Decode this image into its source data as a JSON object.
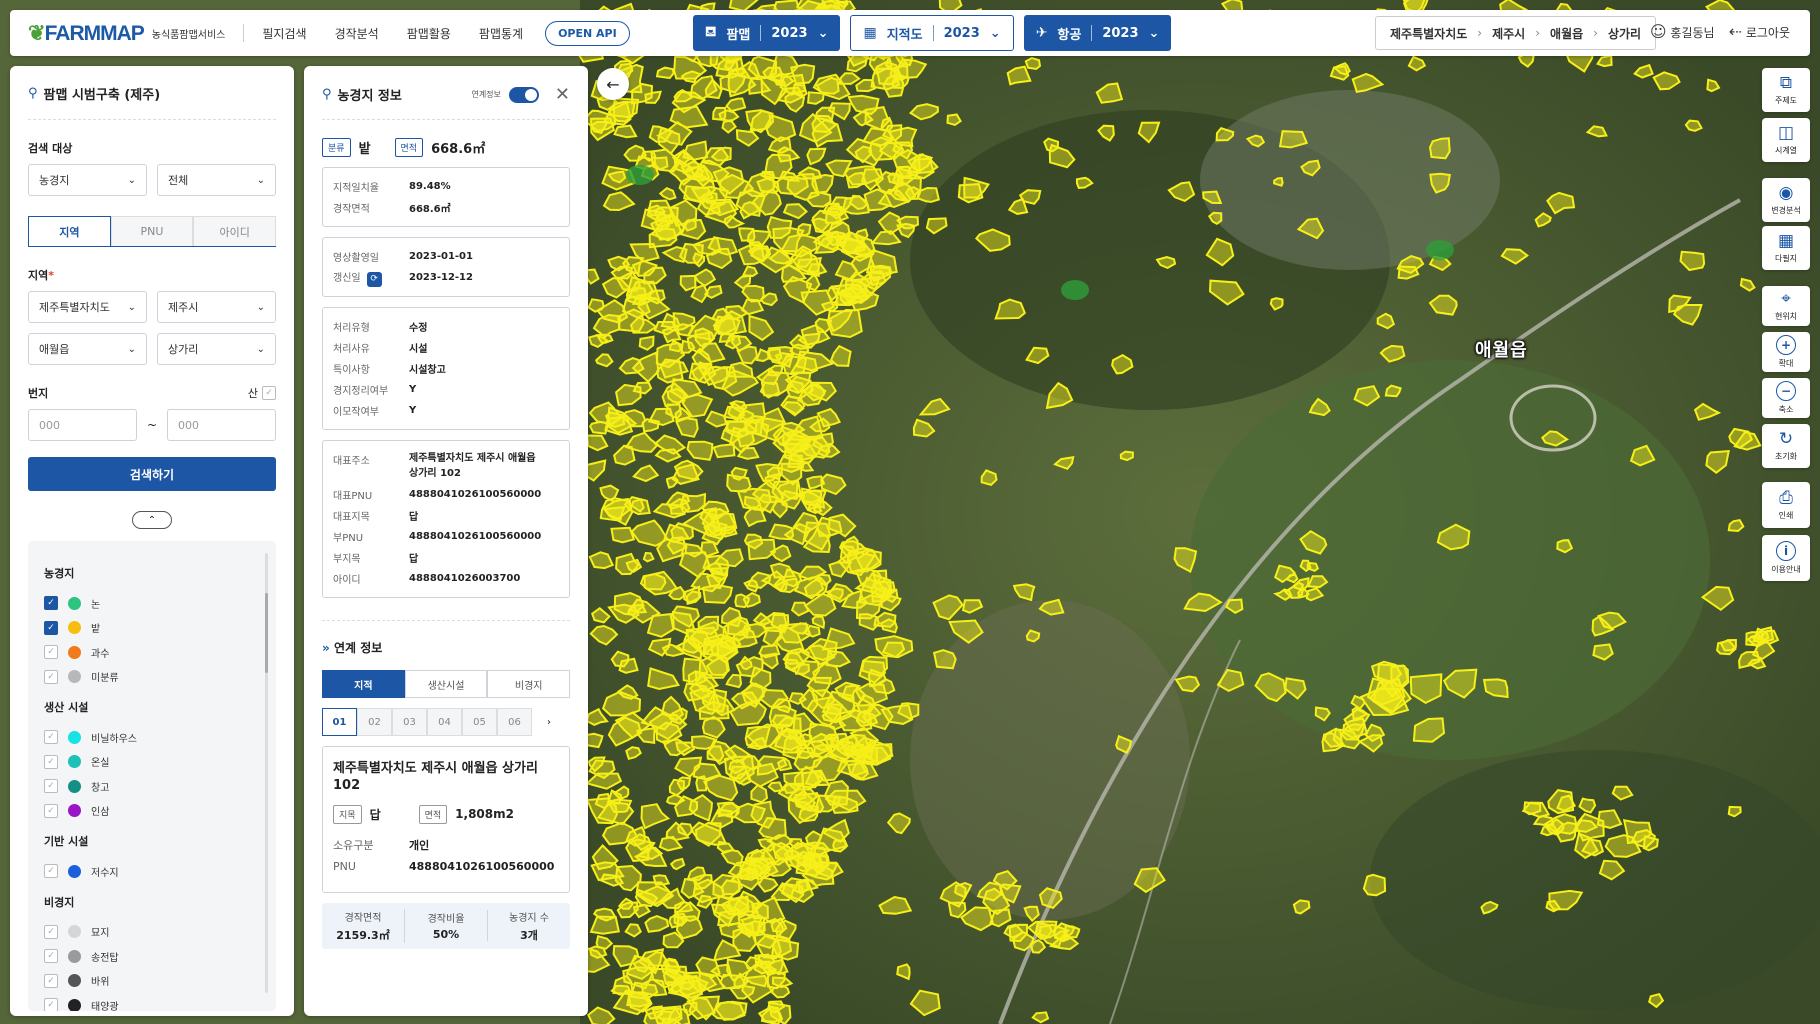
{
  "header": {
    "logo": "FARMMAP",
    "logo_sub": "농식품팜맵서비스",
    "nav": [
      "필지검색",
      "경작분석",
      "팜맵활용",
      "팜맵통계"
    ],
    "open_api": "OPEN API",
    "layers": [
      {
        "label": "팜맵",
        "year": "2023",
        "style": "blue",
        "icon": "farm-icon"
      },
      {
        "label": "지적도",
        "year": "2023",
        "style": "white",
        "icon": "cadastral-icon"
      },
      {
        "label": "항공",
        "year": "2023",
        "style": "blue",
        "icon": "airplane-icon"
      }
    ],
    "breadcrumb": [
      "제주특별자치도",
      "제주시",
      "애월읍",
      "상가리"
    ],
    "user": "홍길동님",
    "logout": "로그아웃"
  },
  "search_panel": {
    "title": "팜맵 시범구축 (제주)",
    "target_label": "검색 대상",
    "target_values": [
      "농경지",
      "전체"
    ],
    "tabs": [
      "지역",
      "PNU",
      "아이디"
    ],
    "region_label": "지역",
    "region_required": "*",
    "region_values": [
      "제주특별자치도",
      "제주시",
      "애월읍",
      "상가리"
    ],
    "lot_label": "번지",
    "mountain_label": "산",
    "lot_from_placeholder": "000",
    "lot_to_placeholder": "000",
    "tilde": "~",
    "search_button": "검색하기"
  },
  "legend": {
    "groups": [
      {
        "title": "농경지",
        "items": [
          {
            "label": "논",
            "color": "#2cc47f",
            "checked": true
          },
          {
            "label": "밭",
            "color": "#f6be10",
            "checked": true
          },
          {
            "label": "과수",
            "color": "#f27a1a",
            "checked": false
          },
          {
            "label": "미분류",
            "color": "#b6b8bb",
            "checked": false
          }
        ]
      },
      {
        "title": "생산 시설",
        "items": [
          {
            "label": "비닐하우스",
            "color": "#17e3e5",
            "checked": false
          },
          {
            "label": "온실",
            "color": "#1ec0b8",
            "checked": false
          },
          {
            "label": "창고",
            "color": "#148f86",
            "checked": false
          },
          {
            "label": "인삼",
            "color": "#9a14c8",
            "checked": false
          }
        ]
      },
      {
        "title": "기반 시설",
        "items": [
          {
            "label": "저수지",
            "color": "#1b5fdc",
            "checked": false
          }
        ]
      },
      {
        "title": "비경지",
        "items": [
          {
            "label": "묘지",
            "color": "#d6d6d6",
            "checked": false
          },
          {
            "label": "송전탑",
            "color": "#9a9a9a",
            "checked": false
          },
          {
            "label": "바위",
            "color": "#555555",
            "checked": false
          },
          {
            "label": "태양광",
            "color": "#222222",
            "checked": false
          }
        ]
      }
    ]
  },
  "info_panel": {
    "title": "농경지 정보",
    "link_label": "연계정보",
    "class_tag": "분류",
    "class_value": "밭",
    "area_tag": "면적",
    "area_value": "668.6㎡",
    "box1": [
      {
        "k": "지적일치율",
        "v": "89.48%"
      },
      {
        "k": "경작면적",
        "v": "668.6㎡"
      }
    ],
    "box2": [
      {
        "k": "영상촬영일",
        "v": "2023-01-01"
      },
      {
        "k": "갱신일",
        "v": "2023-12-12"
      }
    ],
    "box3": [
      {
        "k": "처리유형",
        "v": "수정"
      },
      {
        "k": "처리사유",
        "v": "시설"
      },
      {
        "k": "특이사항",
        "v": "시설창고"
      },
      {
        "k": "경지정리여부",
        "v": "Y"
      },
      {
        "k": "이모작여부",
        "v": "Y"
      }
    ],
    "box4": [
      {
        "k": "대표주소",
        "v": "제주특별자치도 제주시 애월읍 상가리 102"
      },
      {
        "k": "대표PNU",
        "v": "4888041026100560000"
      },
      {
        "k": "대표지목",
        "v": "답"
      },
      {
        "k": "부PNU",
        "v": "4888041026100560000"
      },
      {
        "k": "부지목",
        "v": "답"
      },
      {
        "k": "아이디",
        "v": "4888041026003700"
      }
    ],
    "linked_title": "연계 정보",
    "linked_tabs": [
      "지적",
      "생산시설",
      "비경지"
    ],
    "pages": [
      "01",
      "02",
      "03",
      "04",
      "05",
      "06"
    ],
    "next": "›",
    "card": {
      "title": "제주특별자치도 제주시 애월읍 상가리 102",
      "jimok_tag": "지목",
      "jimok_value": "답",
      "area_tag": "면적",
      "area_value": "1,808m2",
      "owner_k": "소유구분",
      "owner_v": "개인",
      "pnu_k": "PNU",
      "pnu_v": "4888041026100560000"
    },
    "stats": [
      {
        "k": "경작면적",
        "v": "2159.3㎡"
      },
      {
        "k": "경작비율",
        "v": "50%"
      },
      {
        "k": "농경지 수",
        "v": "3개"
      }
    ]
  },
  "map": {
    "town_label": "애월읍",
    "parcel_color": "#f7ef18"
  },
  "toolbar": [
    {
      "label": "주제도",
      "icon": "layers-icon",
      "glyph": "⧉"
    },
    {
      "label": "시계열",
      "icon": "timeseries-icon",
      "glyph": "◫"
    },
    {
      "label": "변경분석",
      "icon": "change-analysis-icon",
      "glyph": "◉"
    },
    {
      "label": "다필지",
      "icon": "multi-parcel-icon",
      "glyph": "▦"
    },
    {
      "label": "현위치",
      "icon": "location-icon",
      "glyph": "⌖"
    },
    {
      "label": "확대",
      "icon": "zoom-in-icon",
      "glyph": "+"
    },
    {
      "label": "축소",
      "icon": "zoom-out-icon",
      "glyph": "−"
    },
    {
      "label": "초기화",
      "icon": "reset-icon",
      "glyph": "↻"
    },
    {
      "label": "인쇄",
      "icon": "print-icon",
      "glyph": "⎙"
    },
    {
      "label": "이용안내",
      "icon": "info-icon",
      "glyph": "i"
    }
  ]
}
